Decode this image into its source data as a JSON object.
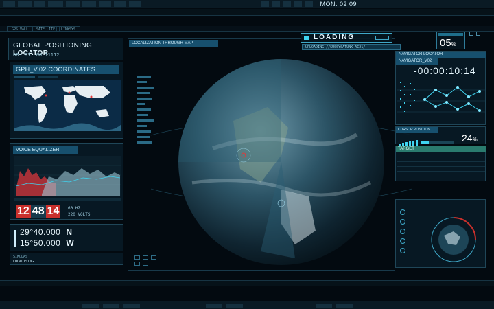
{
  "header": {
    "date": "MON. 02 09"
  },
  "tabs": [
    "GPS VALL",
    "SATELLITE",
    "LINKSYS"
  ],
  "gps": {
    "title_prefix": "GLOBAL POSITIONING ",
    "title_strong": "LOCATOR",
    "timestamp": "08: 01: 00 11112"
  },
  "coordinates": {
    "title": "GPH_V.02 COORDINATES"
  },
  "voice": {
    "title": "VOICE EQUALIZER",
    "clock": {
      "hours": "12",
      "minutes": "48",
      "seconds": "14"
    },
    "freq": "60 HZ",
    "volts": "220 VOLTS"
  },
  "position": {
    "lat": "29°40.000",
    "lat_dir": "N",
    "lon": "15°50.000",
    "lon_dir": "W"
  },
  "loc_strip": {
    "label": "SIMULAS",
    "status": "LOCALISING..."
  },
  "globe": {
    "header": "LOCALIZATION THROUGH MAP"
  },
  "loading": {
    "label": "LOADING",
    "path": "UPLOADING://SUSSYSATUNK_AC21/"
  },
  "percent": {
    "value": "05",
    "unit": "%"
  },
  "navigator": {
    "title": "NAVIGATOR LOCATOR",
    "subtitle": "NAVIGATOR_V02",
    "time": "-00:00:10:14"
  },
  "cursor": {
    "title": "CURSOR POSITION",
    "value": "24",
    "unit": "%"
  },
  "target": {
    "title": "TARGET"
  },
  "colors": {
    "accent": "#3fd4f0",
    "header_blue": "#17506e",
    "alert_red": "#c9302c",
    "target_green": "#2a7b6e"
  }
}
